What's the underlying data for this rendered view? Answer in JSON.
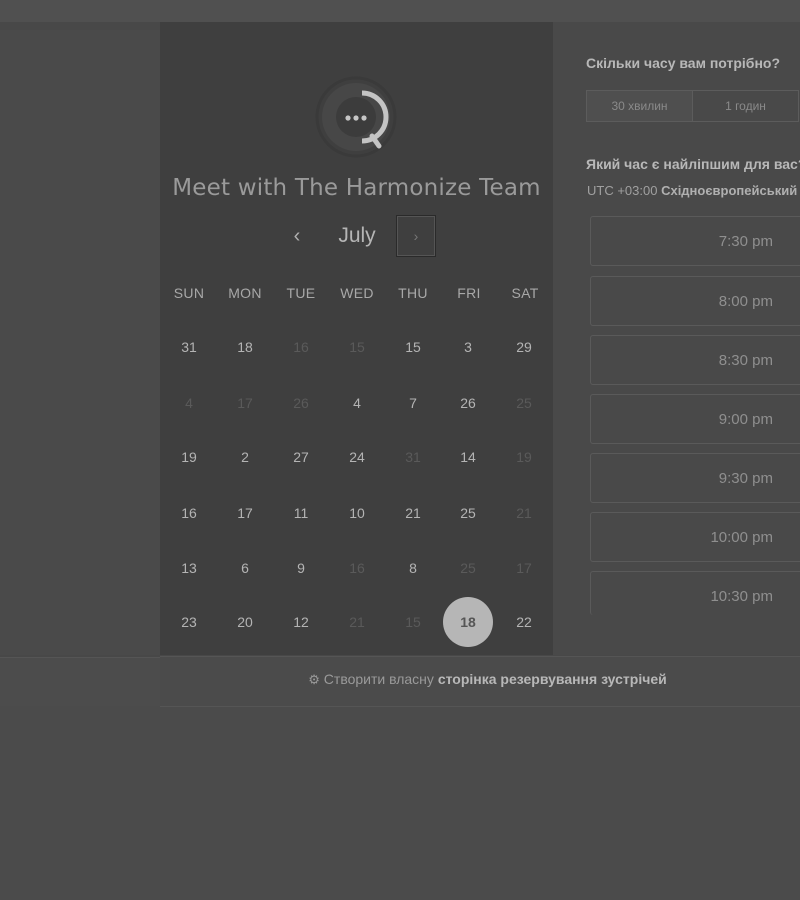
{
  "meeting": {
    "title": "Meet with The Harmonize Team",
    "avatar_icon": "chat-bubble-ellipsis-icon"
  },
  "calendar": {
    "month": "July",
    "prev_label": "‹",
    "next_label": "›",
    "weekdays": [
      "SUN",
      "MON",
      "TUE",
      "WED",
      "THU",
      "FRI",
      "SAT"
    ],
    "weeks": [
      [
        {
          "d": "31",
          "off": false
        },
        {
          "d": "18",
          "off": false
        },
        {
          "d": "16",
          "off": true
        },
        {
          "d": "15",
          "off": true
        },
        {
          "d": "15",
          "off": false
        },
        {
          "d": "3",
          "off": false
        },
        {
          "d": "29",
          "off": false
        }
      ],
      [
        {
          "d": "4",
          "off": true
        },
        {
          "d": "17",
          "off": true
        },
        {
          "d": "26",
          "off": true
        },
        {
          "d": "4",
          "off": false
        },
        {
          "d": "7",
          "off": false
        },
        {
          "d": "26",
          "off": false
        },
        {
          "d": "25",
          "off": true
        }
      ],
      [
        {
          "d": "19",
          "off": false
        },
        {
          "d": "2",
          "off": false
        },
        {
          "d": "27",
          "off": false
        },
        {
          "d": "24",
          "off": false
        },
        {
          "d": "31",
          "off": true
        },
        {
          "d": "14",
          "off": false
        },
        {
          "d": "19",
          "off": true
        }
      ],
      [
        {
          "d": "16",
          "off": false
        },
        {
          "d": "17",
          "off": false
        },
        {
          "d": "11",
          "off": false
        },
        {
          "d": "10",
          "off": false
        },
        {
          "d": "21",
          "off": false
        },
        {
          "d": "25",
          "off": false
        },
        {
          "d": "21",
          "off": true
        }
      ],
      [
        {
          "d": "13",
          "off": false
        },
        {
          "d": "6",
          "off": false
        },
        {
          "d": "9",
          "off": false
        },
        {
          "d": "16",
          "off": true
        },
        {
          "d": "8",
          "off": false
        },
        {
          "d": "25",
          "off": true
        },
        {
          "d": "17",
          "off": true
        }
      ],
      [
        {
          "d": "23",
          "off": false
        },
        {
          "d": "20",
          "off": false
        },
        {
          "d": "12",
          "off": false
        },
        {
          "d": "21",
          "off": true
        },
        {
          "d": "15",
          "off": true
        },
        {
          "d": "18",
          "off": false,
          "selected": true
        },
        {
          "d": "22",
          "off": false
        }
      ]
    ]
  },
  "duration": {
    "question": "Скільки часу вам потрібно?",
    "options": [
      {
        "label": "30 хвилин",
        "active": true
      },
      {
        "label": "1 годин",
        "active": false
      }
    ]
  },
  "times": {
    "question": "Який час є найліпшим для вас?",
    "tz_offset": "UTC +03:00",
    "tz_name": "Східноєвропейський час",
    "slots": [
      "7:30 pm",
      "8:00 pm",
      "8:30 pm",
      "9:00 pm",
      "9:30 pm",
      "10:00 pm",
      "10:30 pm"
    ]
  },
  "footer": {
    "icon": "sprocket-icon",
    "prefix": "Створити власну",
    "link": "сторінка резервування зустрічей"
  }
}
